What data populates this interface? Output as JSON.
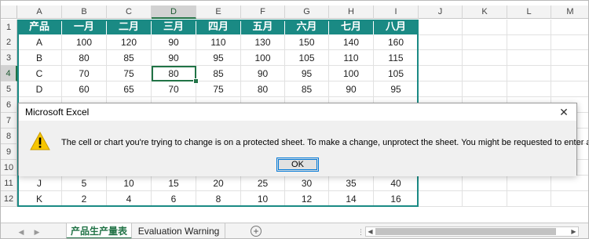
{
  "columns": [
    "A",
    "B",
    "C",
    "D",
    "E",
    "F",
    "G",
    "H",
    "I",
    "J",
    "K",
    "L",
    "M"
  ],
  "rows": [
    "1",
    "2",
    "3",
    "4",
    "5",
    "6",
    "7",
    "8",
    "9",
    "10",
    "11",
    "12"
  ],
  "selected_column": "D",
  "selected_row": "4",
  "table": {
    "header": [
      "产品",
      "一月",
      "二月",
      "三月",
      "四月",
      "五月",
      "六月",
      "七月",
      "八月"
    ],
    "visible_rows": [
      {
        "row": "2",
        "cells": [
          "A",
          "100",
          "120",
          "90",
          "110",
          "130",
          "150",
          "140",
          "160"
        ]
      },
      {
        "row": "3",
        "cells": [
          "B",
          "80",
          "85",
          "90",
          "95",
          "100",
          "105",
          "110",
          "115"
        ]
      },
      {
        "row": "4",
        "cells": [
          "C",
          "70",
          "75",
          "80",
          "85",
          "90",
          "95",
          "100",
          "105"
        ]
      },
      {
        "row": "5",
        "cells": [
          "D",
          "60",
          "65",
          "70",
          "75",
          "80",
          "85",
          "90",
          "95"
        ]
      },
      {
        "row": "11",
        "cells": [
          "J",
          "5",
          "10",
          "15",
          "20",
          "25",
          "30",
          "35",
          "40"
        ]
      },
      {
        "row": "12",
        "cells": [
          "K",
          "2",
          "4",
          "6",
          "8",
          "10",
          "12",
          "14",
          "16"
        ]
      }
    ],
    "header_color": "#1a8a84"
  },
  "dialog": {
    "title": "Microsoft Excel",
    "close_glyph": "✕",
    "icon": "warning-icon",
    "message": "The cell or chart you're trying to change is on a protected sheet. To make a change, unprotect the sheet. You might be requested to enter a password.",
    "ok_label": "OK"
  },
  "tabs": {
    "sheets": [
      "产品生产量表",
      "Evaluation Warning"
    ],
    "active_index": 0,
    "add_glyph": "+",
    "prev_glyph": "◀",
    "next_glyph": "▶",
    "scroll_left_glyph": "◀",
    "scroll_right_glyph": "▶"
  },
  "colors": {
    "accent": "#217346",
    "table_teal": "#1a8a84"
  }
}
